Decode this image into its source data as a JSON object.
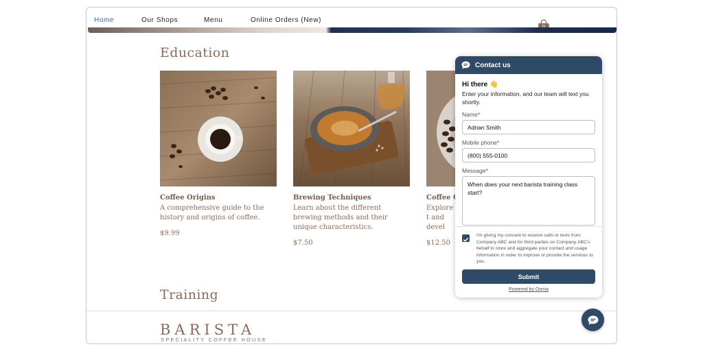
{
  "nav": {
    "items": [
      "Home",
      "Our Shops",
      "Menu",
      "Online Orders (New)"
    ],
    "active": "Home",
    "cart_count": "0"
  },
  "sections": {
    "education_title": "Education",
    "training_title": "Training"
  },
  "cards": [
    {
      "title": "Coffee Origins",
      "description": "A comprehensive guide to the history and origins of coffee.",
      "price": "$9.99",
      "image": "coffee-cup-beans-photo"
    },
    {
      "title": "Brewing Techniques",
      "description": "Learn about the different brewing methods and their unique characteristics.",
      "price": "$7.50",
      "image": "brewing-pan-photo"
    },
    {
      "title": "Coffee Cu",
      "description": "Explore t and devel",
      "price": "$12.50",
      "image": "coffee-bowl-beans-photo"
    }
  ],
  "footer": {
    "brand": "BARISTA",
    "tagline": "SPECIALITY COFFEE HOUSE"
  },
  "widget": {
    "header_title": "Contact us",
    "greeting": "Hi there 👋",
    "intro": "Enter your information, and our team will text you shortly.",
    "name_label": "Name",
    "name_value": "Adrian Smith",
    "phone_label": "Mobile phone",
    "phone_value": "(800) 555-0100",
    "message_label": "Message",
    "message_value": "When does your next barista training class start?",
    "required_mark": "*",
    "consent_text": "I'm giving my consent to receive calls or texts from Company ABC and for third parties on Company ABC's behalf to store and aggregate your contact and usage information in order to improve or provide the services to you.",
    "consent_checked": true,
    "submit_label": "Submit",
    "powered_by": "Powered by Ooma"
  },
  "colors": {
    "accent": "#2e4a66",
    "brand_brown": "#8b6b5a",
    "nav_active": "#2d6fb8"
  }
}
